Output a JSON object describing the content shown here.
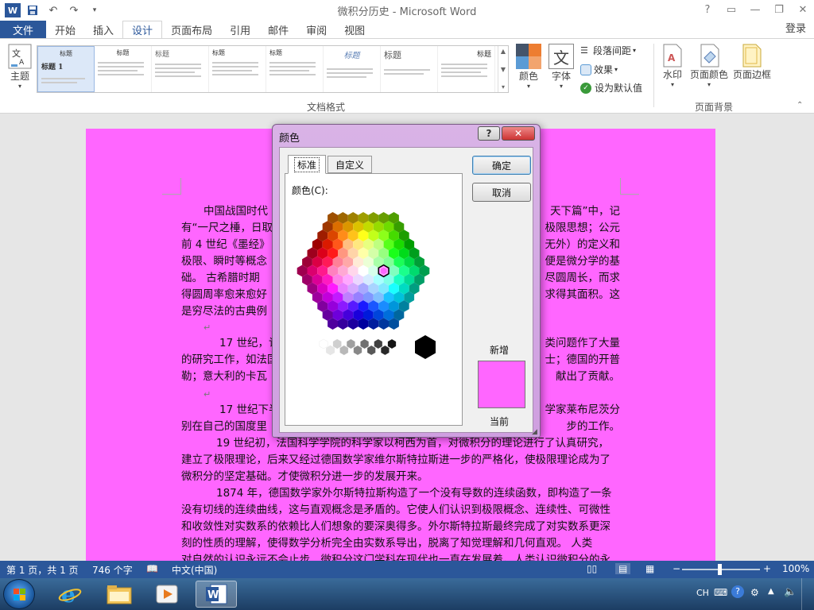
{
  "app": {
    "title": "微积分历史 - Microsoft Word",
    "login": "登录",
    "word_logo": "W"
  },
  "tabs": [
    {
      "label": "文件"
    },
    {
      "label": "开始"
    },
    {
      "label": "插入"
    },
    {
      "label": "设计"
    },
    {
      "label": "页面布局"
    },
    {
      "label": "引用"
    },
    {
      "label": "邮件"
    },
    {
      "label": "审阅"
    },
    {
      "label": "视图"
    }
  ],
  "ribbon": {
    "theme": "主题",
    "thumb1_title": "标题 1",
    "thumb_title": "标题",
    "group_label": "文档格式",
    "colors": "颜色",
    "fonts": "字体",
    "font_glyph": "文",
    "spacing": "段落间距",
    "effects": "效果",
    "set_default": "设为默认值",
    "watermark": "水印",
    "page_color": "页面颜色",
    "page_border": "页面边框",
    "bg_group_label": "页面背景"
  },
  "document": {
    "lines": [
      "中国战国时代",
      "有“一尺之棰，日取",
      "前 4 世纪《墨经》",
      "极限、瞬时等概念",
      "础。    古希腊时期",
      "得圆周率愈来愈好",
      "是穷尽法的古典例",
      "17 世纪，许",
      "的研究工作，如法国",
      "勒；意大利的卡瓦",
      "17 世纪下半",
      "别在自己的国度里",
      "19 世纪初，法国科学学院的科学家以柯西为首，对微积分的理论进行了认真研究，",
      "建立了极限理论，后来又经过德国数学家维尔斯特拉斯进一步的严格化，使极限理论成为了",
      "微积分的坚定基础。才使微积分进一步的发展开来。",
      "1874 年，德国数学家外尔斯特拉斯构造了一个没有导数的连续函数，即构造了一条",
      "没有切线的连续曲线，这与直观概念是矛盾的。它使人们认识到极限概念、连续性、可微性",
      "和收敛性对实数系的依赖比人们想象的要深奥得多。外尔斯特拉斯最终完成了对实数系更深",
      "刻的性质的理解，使得数学分析完全由实数系导出，脱离了知觉理解和几何直观。    人类",
      "对自然的认识永远不会止步，微积分这门学科在现代也一直在发展着。人类认识微积分的永"
    ],
    "right_fragments": [
      "天下篇”中，记",
      "极限思想；公元",
      "无外）的定义和",
      "便是微分学的基",
      "尽圆周长，而求",
      "求得其面积。这",
      "类问题作了大量",
      "士；德国的开普",
      "献出了贡献。",
      "学家莱布尼茨分",
      "步的工作。"
    ],
    "page_color": "#ff66ff"
  },
  "dialog": {
    "title": "颜色",
    "help": "?",
    "close": "✕",
    "tab_standard": "标准",
    "tab_custom": "自定义",
    "colors_label": "颜色(C):",
    "ok": "确定",
    "cancel": "取消",
    "new_label": "新增",
    "current_label": "当前",
    "new_color": "#ff66ff"
  },
  "status": {
    "page": "第 1 页，共 1 页",
    "words": "746 个字",
    "lang": "中文(中国)",
    "zoom": "100%"
  },
  "taskbar": {
    "ime": "CH"
  }
}
